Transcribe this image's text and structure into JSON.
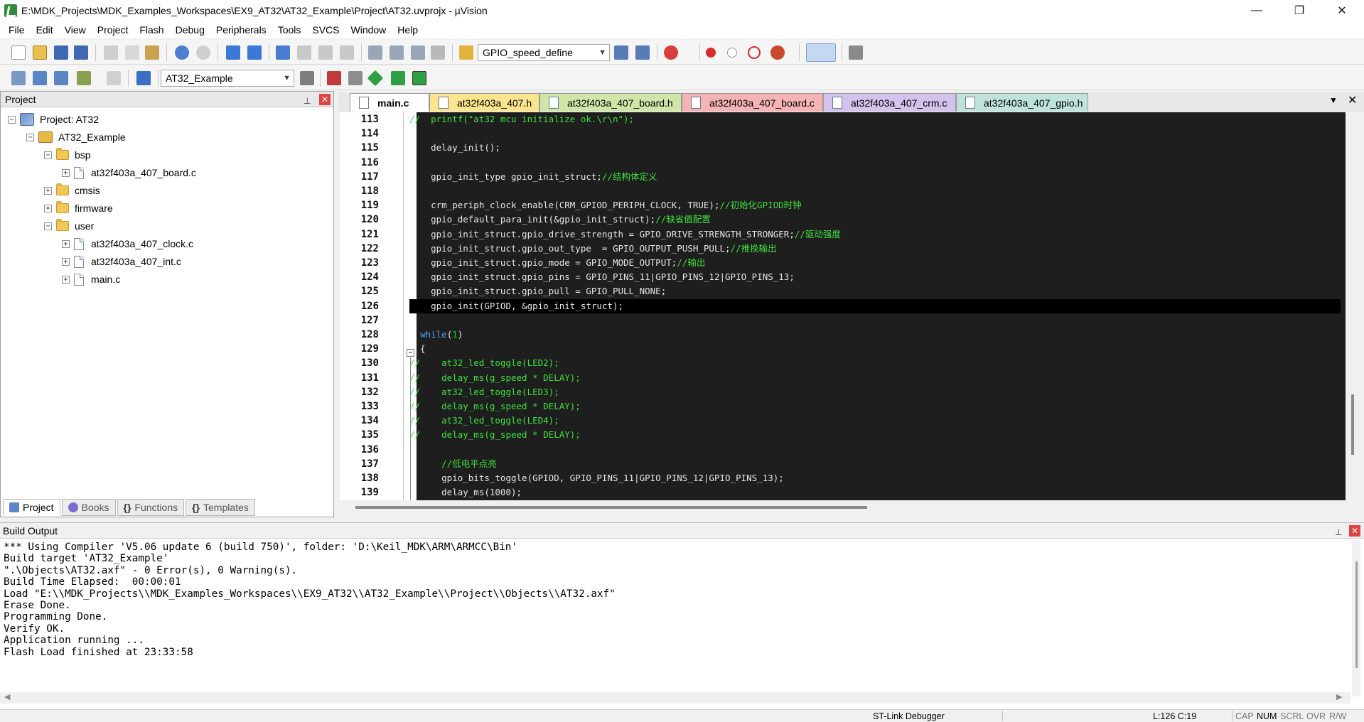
{
  "window": {
    "title": "E:\\MDK_Projects\\MDK_Examples_Workspaces\\EX9_AT32\\AT32_Example\\Project\\AT32.uvprojx - µVision",
    "minimize": "—",
    "maximize": "❐",
    "close": "✕"
  },
  "menu": [
    "File",
    "Edit",
    "View",
    "Project",
    "Flash",
    "Debug",
    "Peripherals",
    "Tools",
    "SVCS",
    "Window",
    "Help"
  ],
  "toolbar": {
    "find_combo": "GPIO_speed_define",
    "target_combo": "AT32_Example"
  },
  "project_panel": {
    "title": "Project",
    "tree": [
      {
        "label": "Project: AT32",
        "kind": "project",
        "toggle": "−"
      },
      {
        "label": "AT32_Example",
        "kind": "target",
        "toggle": "−"
      },
      {
        "label": "bsp",
        "kind": "folder",
        "toggle": "−"
      },
      {
        "label": "at32f403a_407_board.c",
        "kind": "file",
        "toggle": "+"
      },
      {
        "label": "cmsis",
        "kind": "folder",
        "toggle": "+"
      },
      {
        "label": "firmware",
        "kind": "folder",
        "toggle": "+"
      },
      {
        "label": "user",
        "kind": "folder",
        "toggle": "−"
      },
      {
        "label": "at32f403a_407_clock.c",
        "kind": "file",
        "toggle": "+"
      },
      {
        "label": "at32f403a_407_int.c",
        "kind": "file",
        "toggle": "+"
      },
      {
        "label": "main.c",
        "kind": "file",
        "toggle": "+"
      }
    ],
    "tabs": [
      "Project",
      "Books",
      "Functions",
      "Templates"
    ]
  },
  "editor": {
    "tabs": [
      {
        "label": "main.c",
        "color": "#ffffff",
        "active": true
      },
      {
        "label": "at32f403a_407.h",
        "color": "#fbe48e"
      },
      {
        "label": "at32f403a_407_board.h",
        "color": "#cfe6a8"
      },
      {
        "label": "at32f403a_407_board.c",
        "color": "#f6b3b6"
      },
      {
        "label": "at32f403a_407_crm.c",
        "color": "#d2c2ec"
      },
      {
        "label": "at32f403a_407_gpio.h",
        "color": "#bfe3da"
      }
    ],
    "line_numbers": [
      "113",
      "114",
      "115",
      "116",
      "117",
      "118",
      "119",
      "120",
      "121",
      "122",
      "123",
      "124",
      "125",
      "126",
      "127",
      "128",
      "129",
      "130",
      "131",
      "132",
      "133",
      "134",
      "135",
      "136",
      "137",
      "138",
      "139"
    ],
    "lines": [
      "//  printf(\"at32 mcu initialize ok.\\r\\n\");",
      "",
      "    delay_init();",
      "",
      "    gpio_init_type gpio_init_struct;//结构体定义",
      "",
      "    crm_periph_clock_enable(CRM_GPIOD_PERIPH_CLOCK, TRUE);//初始化GPIOD时钟",
      "    gpio_default_para_init(&gpio_init_struct);//缺省值配置",
      "    gpio_init_struct.gpio_drive_strength = GPIO_DRIVE_STRENGTH_STRONGER;//驱动强度",
      "    gpio_init_struct.gpio_out_type  = GPIO_OUTPUT_PUSH_PULL;//推挽输出",
      "    gpio_init_struct.gpio_mode = GPIO_MODE_OUTPUT;//输出",
      "    gpio_init_struct.gpio_pins = GPIO_PINS_11|GPIO_PINS_12|GPIO_PINS_13;",
      "    gpio_init_struct.gpio_pull = GPIO_PULL_NONE;",
      "    gpio_init(GPIOD, &gpio_init_struct);",
      "",
      "  while(1)",
      "  {",
      "//    at32_led_toggle(LED2);",
      "//    delay_ms(g_speed * DELAY);",
      "//    at32_led_toggle(LED3);",
      "//    delay_ms(g_speed * DELAY);",
      "//    at32_led_toggle(LED4);",
      "//    delay_ms(g_speed * DELAY);",
      "",
      "      //低电平点亮",
      "      gpio_bits_toggle(GPIOD, GPIO_PINS_11|GPIO_PINS_12|GPIO_PINS_13);",
      "      delay_ms(1000);"
    ],
    "current_line_index": 13
  },
  "build_output": {
    "title": "Build Output",
    "lines": [
      "*** Using Compiler 'V5.06 update 6 (build 750)', folder: 'D:\\Keil_MDK\\ARM\\ARMCC\\Bin'",
      "Build target 'AT32_Example'",
      "\".\\Objects\\AT32.axf\" - 0 Error(s), 0 Warning(s).",
      "Build Time Elapsed:  00:00:01",
      "Load \"E:\\\\MDK_Projects\\\\MDK_Examples_Workspaces\\\\EX9_AT32\\\\AT32_Example\\\\Project\\\\Objects\\\\AT32.axf\"",
      "Erase Done.",
      "Programming Done.",
      "Verify OK.",
      "Application running ...",
      "Flash Load finished at 23:33:58"
    ]
  },
  "status": {
    "debugger": "ST-Link Debugger",
    "position": "L:126 C:19",
    "cap": "CAP",
    "num": "NUM",
    "scrl": "SCRL",
    "ovr": "OVR",
    "rw": "R/W"
  }
}
